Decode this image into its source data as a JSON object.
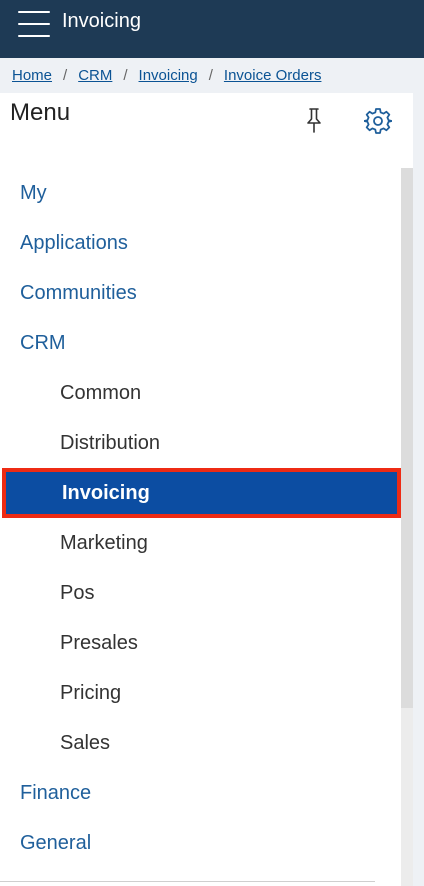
{
  "header": {
    "title": "Invoicing"
  },
  "breadcrumb": [
    {
      "label": "Home"
    },
    {
      "label": "CRM"
    },
    {
      "label": "Invoicing"
    },
    {
      "label": "Invoice Orders"
    }
  ],
  "breadcrumb_separator": "/",
  "panel": {
    "title": "Menu"
  },
  "menu": {
    "items": [
      {
        "label": "My",
        "level": "top"
      },
      {
        "label": "Applications",
        "level": "top"
      },
      {
        "label": "Communities",
        "level": "top"
      },
      {
        "label": "CRM",
        "level": "top"
      },
      {
        "label": "Common",
        "level": "sub"
      },
      {
        "label": "Distribution",
        "level": "sub"
      },
      {
        "label": "Invoicing",
        "level": "sub",
        "active": true
      },
      {
        "label": "Marketing",
        "level": "sub"
      },
      {
        "label": "Pos",
        "level": "sub"
      },
      {
        "label": "Presales",
        "level": "sub"
      },
      {
        "label": "Pricing",
        "level": "sub"
      },
      {
        "label": "Sales",
        "level": "sub"
      },
      {
        "label": "Finance",
        "level": "top"
      },
      {
        "label": "General",
        "level": "top"
      }
    ]
  },
  "colors": {
    "header_bg": "#1e3a55",
    "link": "#0b5394",
    "active_bg": "#0c4da2",
    "active_border": "#ee2b14"
  },
  "icons": {
    "menu": "hamburger-icon",
    "pin": "pin-icon",
    "settings": "gear-icon"
  }
}
